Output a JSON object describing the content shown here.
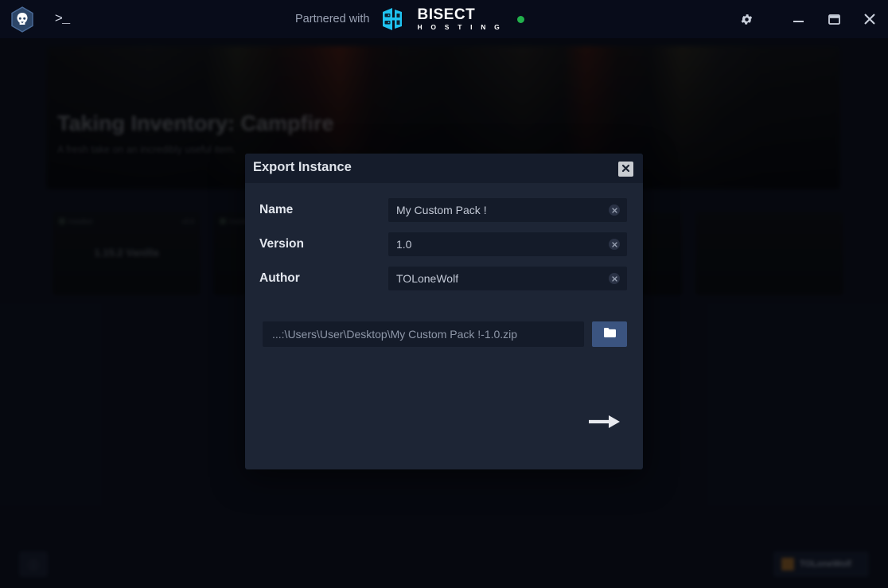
{
  "titlebar": {
    "logo_icon": "app-logo-hexagon",
    "console_label": ">_",
    "console_icon": "console-icon",
    "partner_label": "Partnered with",
    "partner_brand": "BISECT",
    "partner_brand_sub": "H O S T I N G",
    "partner_mark_icon": "bisect-hosting-logo-icon",
    "status_icon": "status-online-dot",
    "status_color": "#22b14c",
    "settings_icon": "gear-icon",
    "minimize_icon": "minimize-icon",
    "maximize_icon": "maximize-icon",
    "close_icon": "close-icon"
  },
  "backdrop": {
    "banner": {
      "title": "Taking Inventory: Campfire",
      "subtitle": "A fresh take on an incredibly useful item."
    },
    "instances": [
      {
        "status": "Installed",
        "badge": "v0.6",
        "name": "1.15.2 Vanilla"
      },
      {
        "status": "Installed",
        "badge": "",
        "name": ""
      },
      {
        "status": "",
        "badge": "",
        "name": ""
      },
      {
        "status": "",
        "badge": "",
        "name": ""
      },
      {
        "status": "",
        "badge": "",
        "name": ""
      }
    ],
    "bottombar": {
      "left_icon": "news-icon",
      "account_name": "TOLoneWolf",
      "account_avatar_icon": "avatar-icon"
    }
  },
  "dialog": {
    "title": "Export Instance",
    "close_icon": "close-icon",
    "fields": [
      {
        "label": "Name",
        "value": "My Custom Pack !",
        "clear_icon": "clear-circle-icon"
      },
      {
        "label": "Version",
        "value": "1.0",
        "clear_icon": "clear-circle-icon"
      },
      {
        "label": "Author",
        "value": "TOLoneWolf",
        "clear_icon": "clear-circle-icon"
      }
    ],
    "path": {
      "value": "...:\\Users\\User\\Desktop\\My Custom Pack !-1.0.zip",
      "browse_icon": "folder-icon",
      "browse_color": "#3b5480"
    },
    "next_icon": "arrow-right-icon"
  }
}
